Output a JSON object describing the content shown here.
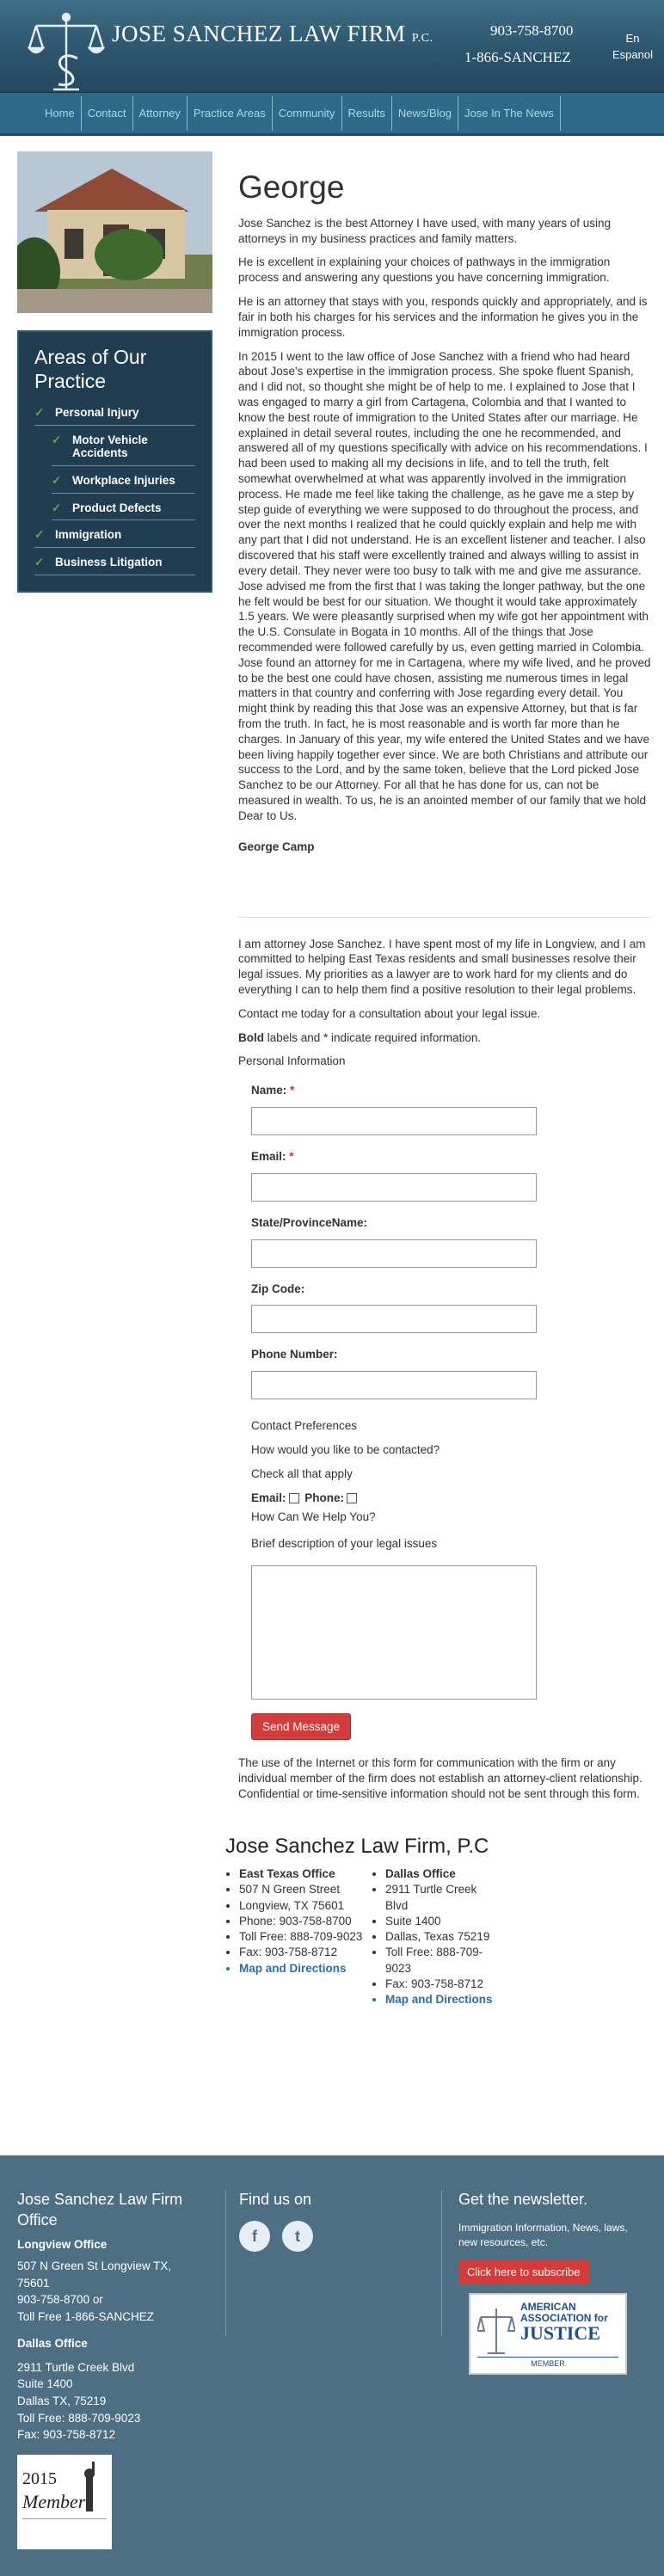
{
  "header": {
    "firm_name": "JOSE SANCHEZ LAW FIRM",
    "firm_suffix": "P.C.",
    "phone_primary": "903-758-8700",
    "phone_toll_free": "1-866-SANCHEZ",
    "lang_line1": "En",
    "lang_line2": "Espanol"
  },
  "nav": [
    "Home",
    "Contact",
    "Attorney",
    "Practice Areas",
    "Community",
    "Results",
    "News/Blog",
    "Jose In The News"
  ],
  "sidebar": {
    "areas_title": "Areas of Our Practice",
    "items": [
      {
        "label": "Personal Injury",
        "sub": false
      },
      {
        "label": "Motor Vehicle Accidents",
        "sub": true
      },
      {
        "label": "Workplace Injuries",
        "sub": true
      },
      {
        "label": "Product Defects",
        "sub": true
      },
      {
        "label": "Immigration",
        "sub": false
      },
      {
        "label": "Business Litigation",
        "sub": false
      }
    ]
  },
  "testimonial": {
    "title": "George",
    "paragraphs": [
      "Jose Sanchez is the best Attorney I have used, with many years of using attorneys in my business practices and family matters.",
      "He is excellent in explaining your choices of pathways in the immigration process and answering any questions you have concerning immigration.",
      "He is an attorney that stays with you, responds quickly and appropriately, and is fair in both his charges for his services and the information he gives you in the immigration process.",
      "In 2015 I went to the law office of Jose Sanchez with a friend who had heard about Jose's expertise in the immigration process. She spoke fluent Spanish, and I did not, so thought she might be of help to me. I explained to Jose that I was engaged to marry a girl from Cartagena, Colombia and that I wanted to know the best route of immigration to the United States after our marriage. He explained in detail several routes, including the one he recommended, and answered all of my questions specifically with advice on his recommendations. I had been used to making all my decisions in life, and to tell the truth, felt somewhat overwhelmed at what was apparently involved in the immigration process. He made me feel like taking the challenge, as he gave me a step by step guide of everything we were supposed to do throughout the process, and over the next months I realized that he could quickly explain and help me with any part that I did not understand. He is an excellent listener and teacher. I also discovered that his staff were excellently trained and always willing to assist in every detail. They never were too busy to talk with me and give me assurance. Jose advised me from the first that I was taking the longer pathway, but the one he felt would be best for our situation. We thought it would take approximately 1.5 years. We were pleasantly surprised when my wife got her appointment with the U.S. Consulate in Bogata in 10 months. All of the things that Jose recommended were followed carefully by us, even getting married in Colombia. Jose found an attorney for me in Cartagena, where my wife lived, and he proved to be the best one could have chosen, assisting me numerous times in legal matters in that country and conferring with Jose regarding every detail. You might think by reading this that Jose was an expensive Attorney, but that is far from the truth. In fact, he is most reasonable and is worth far more than he charges. In January of this year, my wife entered the United States and we have been living happily together ever since. We are both Christians and attribute our success to the Lord, and by the same token, believe that the Lord picked Jose Sanchez to be our Attorney. For all that he has done for us, can not be measured in wealth. To us, he is an anointed member of our family that we hold Dear to Us."
    ],
    "signature": "George Camp"
  },
  "contact": {
    "intro": "I am attorney Jose Sanchez. I have spent most of my life in Longview, and I am committed to helping East Texas residents and small businesses resolve their legal issues. My priorities as a lawyer are to work hard for my clients and do everything I can to help them find a positive resolution to their legal problems.",
    "cta": "Contact me today for a consultation about your legal issue.",
    "required_bold": "Bold",
    "required_rest": " labels and * indicate required information.",
    "personal_info": "Personal Information",
    "fields": [
      {
        "label": "Name:",
        "required": true
      },
      {
        "label": "Email:",
        "required": true
      },
      {
        "label": "State/ProvinceName:",
        "required": false
      },
      {
        "label": "Zip Code:",
        "required": false
      },
      {
        "label": "Phone Number:",
        "required": false
      }
    ],
    "contact_prefs": "Contact Preferences",
    "how_contact": "How would you like to be contacted?",
    "check_all": "Check all that apply",
    "opt_email": "Email:",
    "opt_phone": "Phone:",
    "help_q": "How Can We Help You?",
    "brief_desc": "Brief description of your legal issues",
    "send_label": "Send Message",
    "disclaimer": "The use of the Internet or this form for communication with the firm or any individual member of the firm does not establish an attorney-client relationship. Confidential or time-sensitive information should not be sent through this form."
  },
  "offices": {
    "title": "Jose Sanchez Law Firm, P.C",
    "east": [
      "East Texas Office",
      "507 N Green Street",
      "Longview, TX 75601",
      "Phone: 903-758-8700",
      "Toll Free: 888-709-9023",
      "Fax: 903-758-8712",
      "Map and Directions"
    ],
    "dallas": [
      "Dallas Office",
      "2911 Turtle Creek Blvd",
      "Suite 1400",
      "Dallas, Texas 75219",
      "Toll Free: 888-709-9023",
      "Fax: 903-758-8712",
      "Map and Directions"
    ]
  },
  "footer": {
    "firm": "Jose Sanchez Law Firm Office",
    "longview_h": "Longview Office",
    "longview_lines": [
      "507 N Green St Longview TX, 75601",
      "903-758-8700 or",
      "Toll Free 1-866-SANCHEZ"
    ],
    "dallas_h": "Dallas Office",
    "dallas_lines": [
      "2911 Turtle Creek Blvd",
      "Suite 1400",
      "Dallas TX, 75219",
      "Toll Free: 888-709-9023",
      "Fax: 903-758-8712"
    ],
    "find_us": "Find us on",
    "facebook": "f",
    "twitter": "t",
    "newsletter_h": "Get the newsletter.",
    "newsletter_text": "Immigration Information, News, laws, new resources, etc.",
    "subscribe": "Click here to subscribe",
    "aaj_line1": "AMERICAN",
    "aaj_line2": "ASSOCIATION for",
    "aaj_line3": "JUSTICE",
    "aaj_line4": "MEMBER",
    "badge_year": "2015",
    "badge_word": "Member"
  }
}
